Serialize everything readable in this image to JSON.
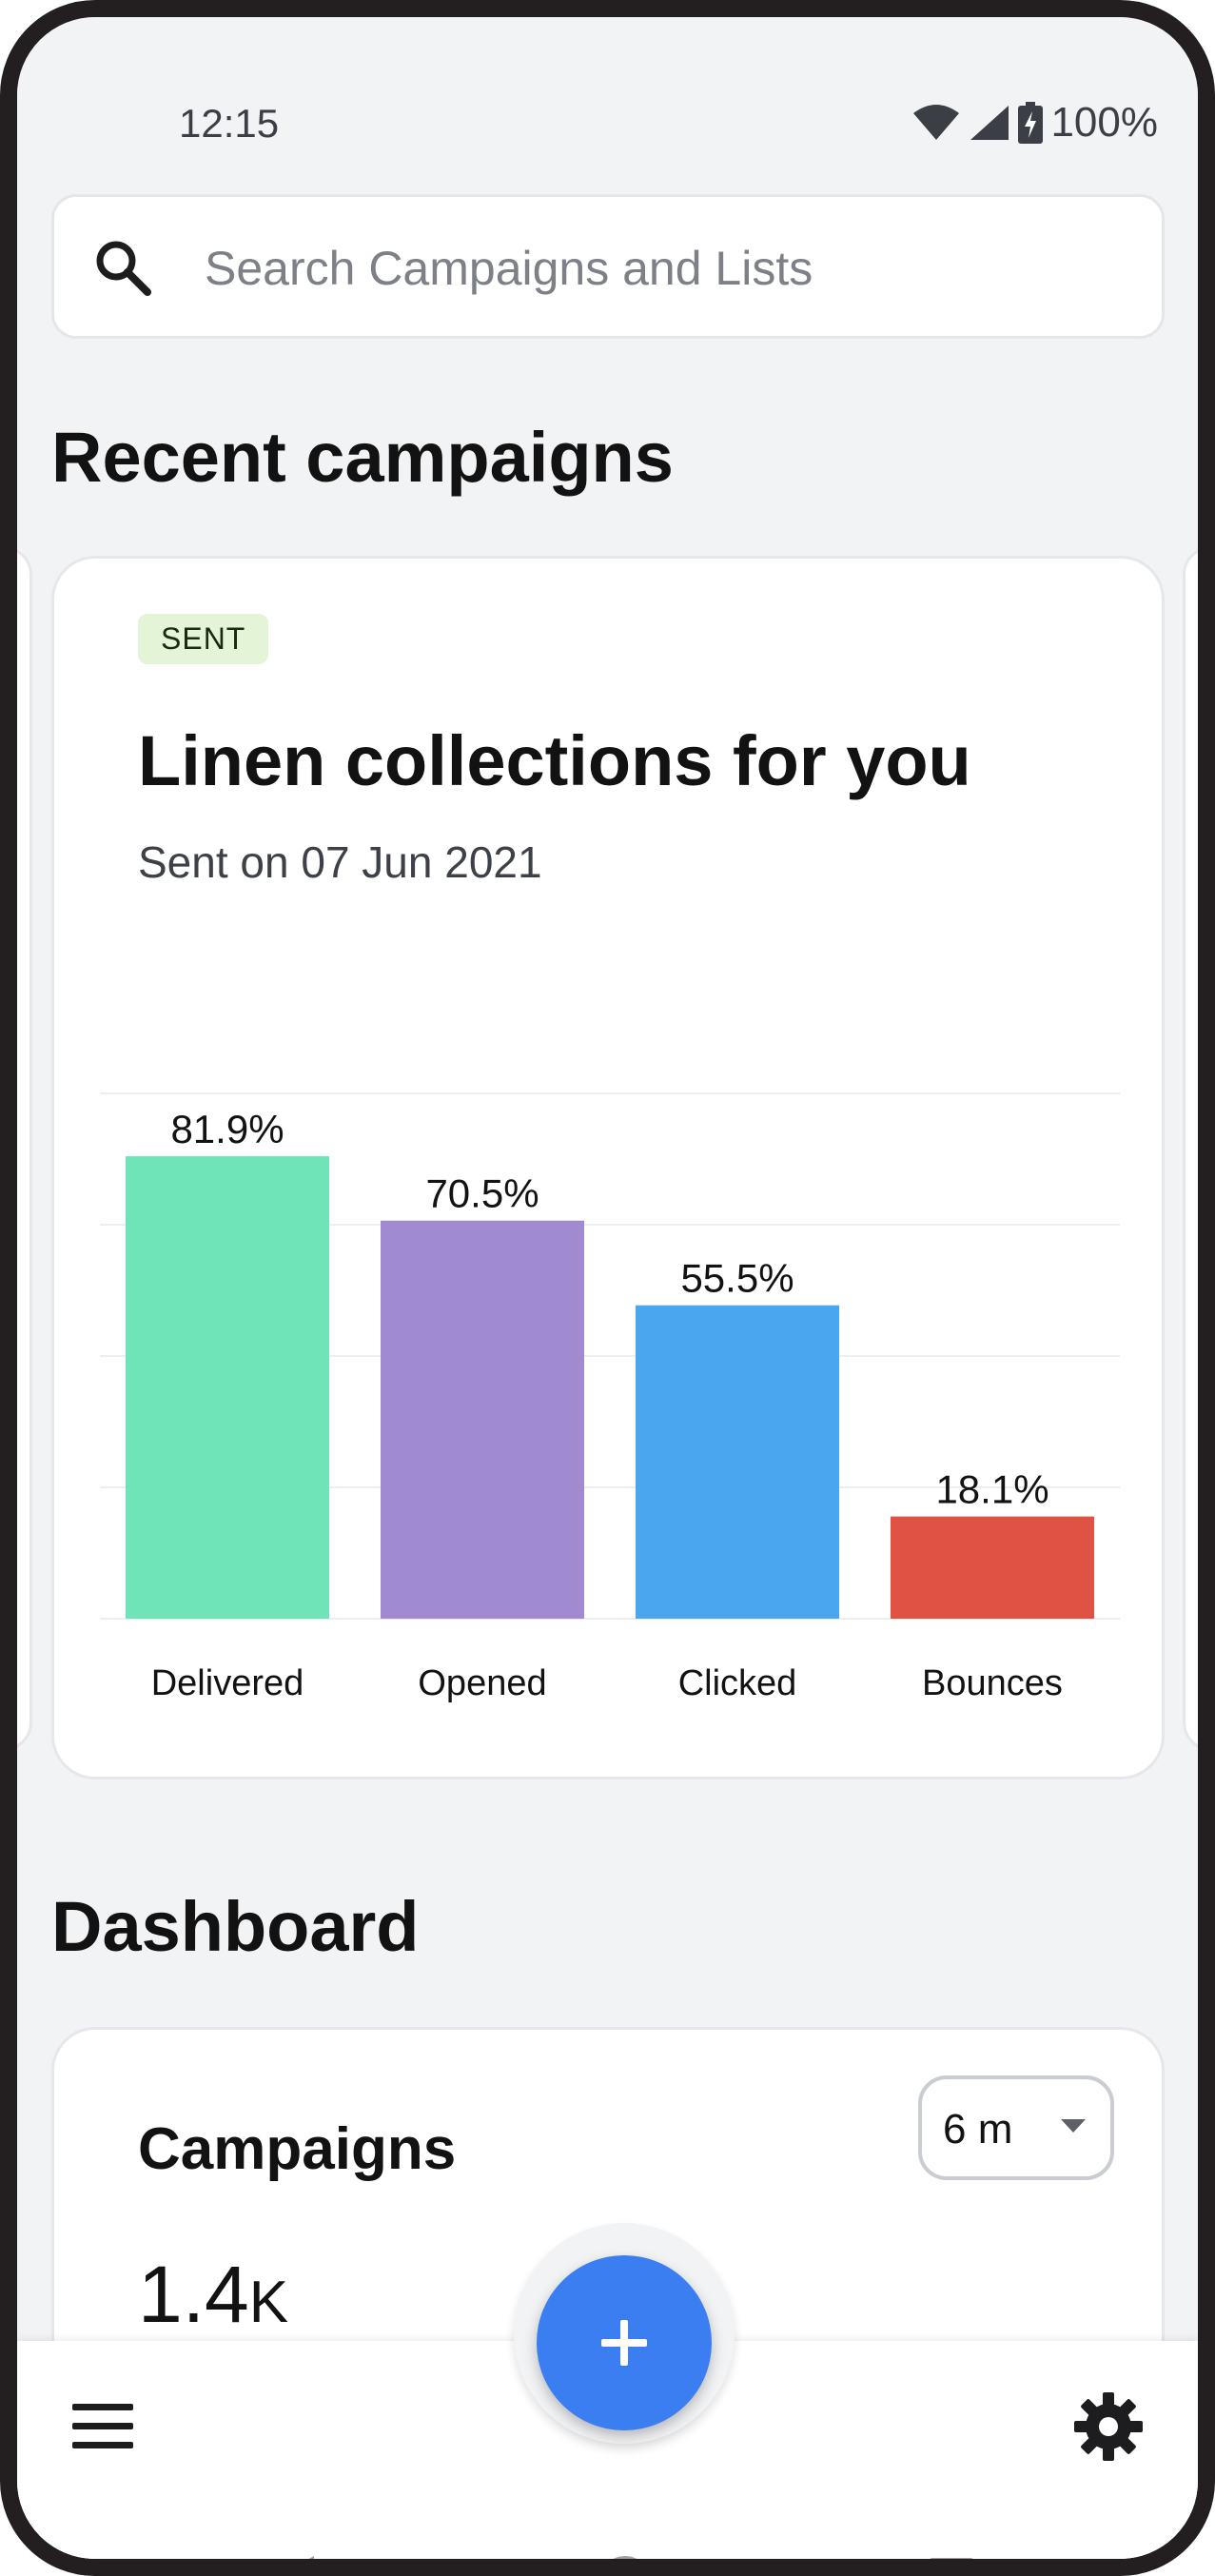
{
  "status_bar": {
    "time": "12:15",
    "battery": "100%",
    "icons": [
      "wifi-icon",
      "signal-icon",
      "battery-charging-icon"
    ]
  },
  "search": {
    "placeholder": "Search Campaigns and Lists",
    "icon": "search-icon"
  },
  "recent": {
    "heading": "Recent campaigns",
    "campaign": {
      "status": "SENT",
      "title": "Linen collections for you",
      "date": "Sent on 07 Jun 2021"
    }
  },
  "chart_data": {
    "type": "bar",
    "categories": [
      "Delivered",
      "Opened",
      "Clicked",
      "Bounces"
    ],
    "values": [
      81.9,
      70.5,
      55.5,
      18.1
    ],
    "value_labels": [
      "81.9%",
      "70.5%",
      "55.5%",
      "18.1%"
    ],
    "colors": [
      "#6fe4b8",
      "#a08ad0",
      "#4aa6ee",
      "#e05243"
    ],
    "ylim": [
      0,
      90
    ],
    "grid": true,
    "title": "",
    "xlabel": "",
    "ylabel": ""
  },
  "dashboard": {
    "heading": "Dashboard",
    "card_title": "Campaigns",
    "range": "6 m",
    "count": "1.4",
    "count_suffix": "K"
  },
  "colors": {
    "background": "#f2f3f5",
    "fab": "#3b7ef2",
    "sent_badge": "#e4f4d7"
  },
  "bottom_bar": {
    "icons": [
      "menu-icon",
      "add-icon",
      "gear-icon"
    ]
  }
}
